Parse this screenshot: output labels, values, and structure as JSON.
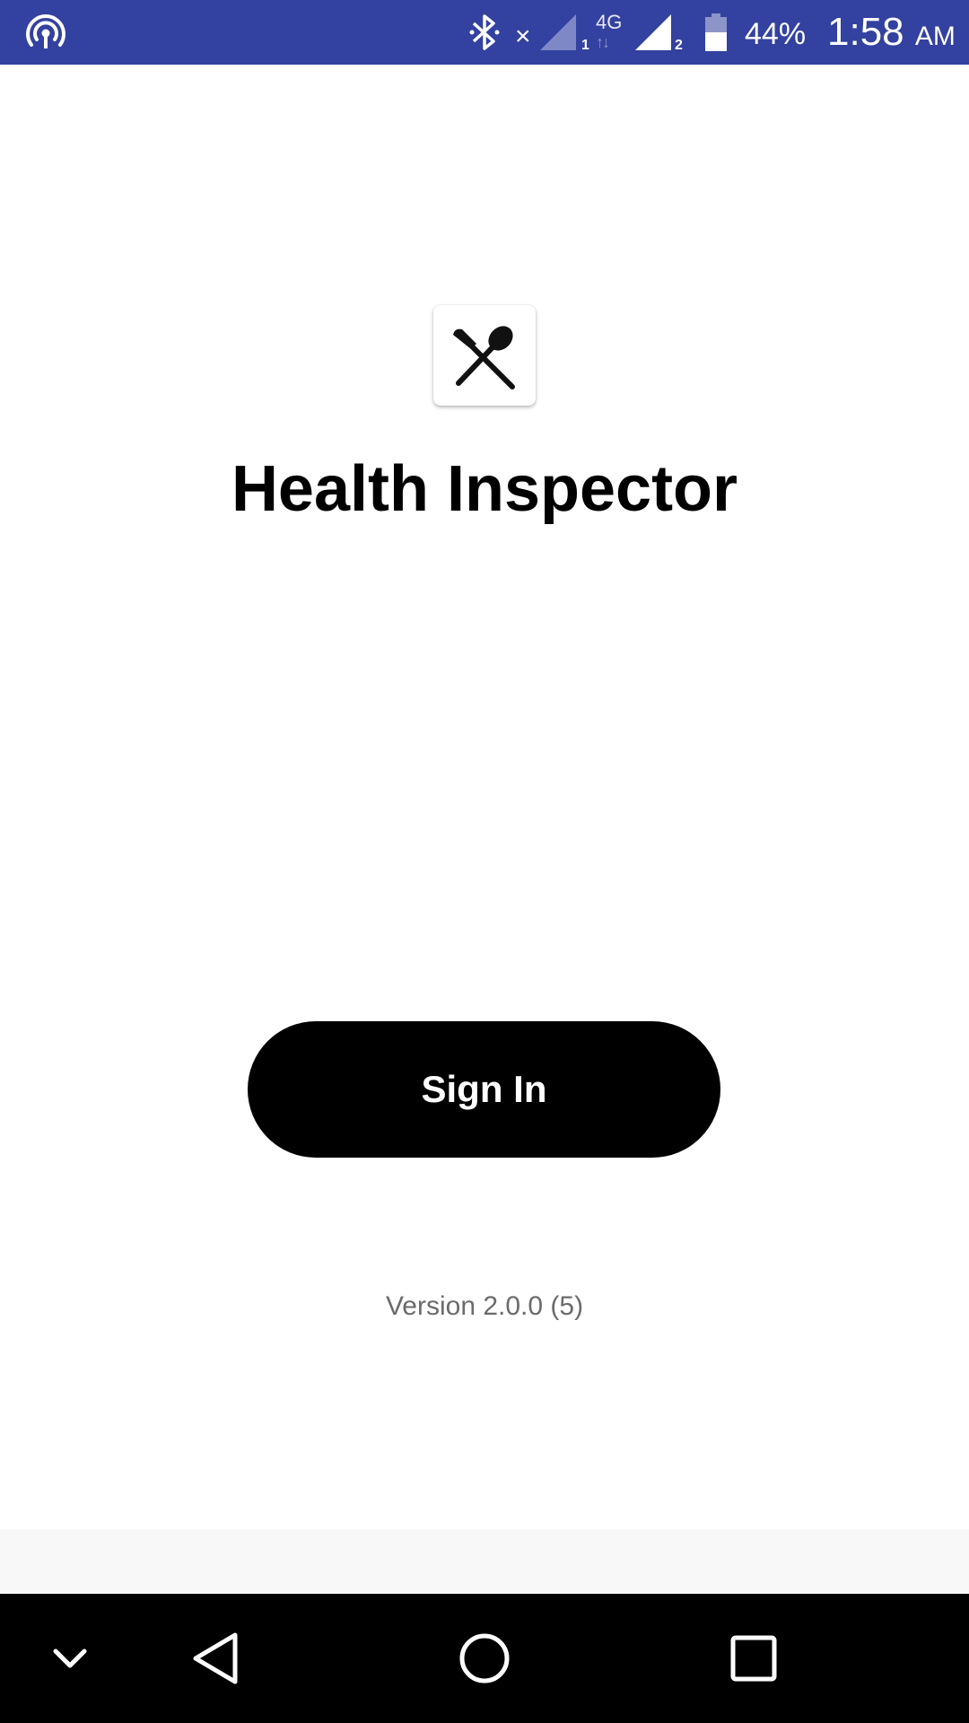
{
  "status_bar": {
    "network_type": "4G",
    "sim1_label": "1",
    "sim2_label": "2",
    "battery_percent": "44%",
    "time": "1:58",
    "ampm": "AM",
    "no_signal_mark": "×",
    "background_color": "#3341a0",
    "icons": [
      "hotspot-icon",
      "bluetooth-icon",
      "signal-icon",
      "signal-icon",
      "battery-icon"
    ]
  },
  "app": {
    "icon_name": "utensils-icon",
    "title": "Health Inspector",
    "sign_in_label": "Sign In",
    "version_text": "Version 2.0.0 (5)"
  },
  "nav_bar": {
    "icons": [
      "chevron-down-icon",
      "back-icon",
      "home-icon",
      "recents-icon"
    ]
  }
}
